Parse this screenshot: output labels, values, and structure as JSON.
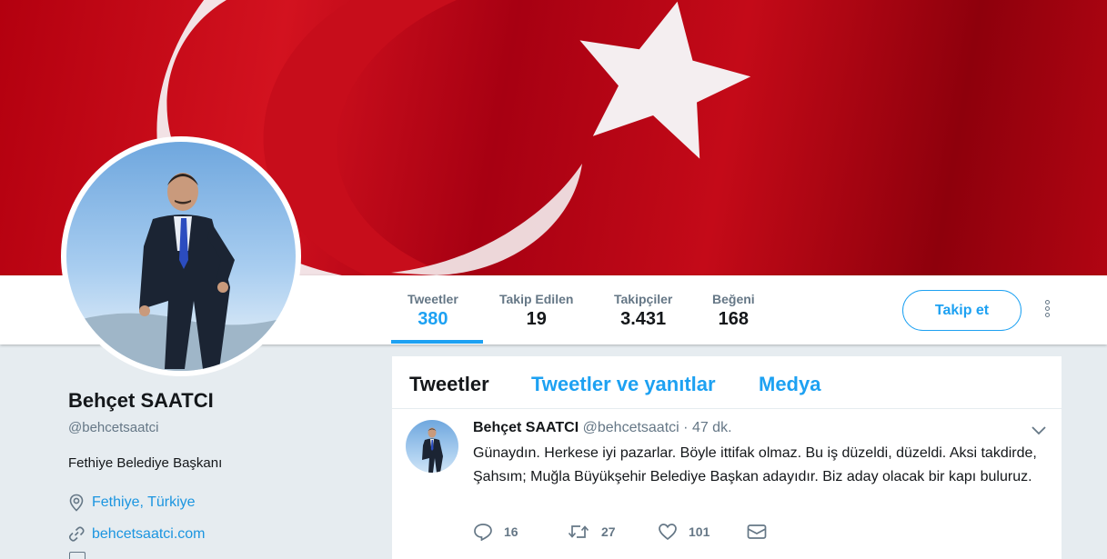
{
  "profile": {
    "name": "Behçet SAATCI",
    "handle": "@behcetsaatci",
    "bio": "Fethiye Belediye Başkanı",
    "location": "Fethiye, Türkiye",
    "website": "behcetsaatci.com"
  },
  "stats": [
    {
      "label": "Tweetler",
      "value": "380"
    },
    {
      "label": "Takip Edilen",
      "value": "19"
    },
    {
      "label": "Takipçiler",
      "value": "3.431"
    },
    {
      "label": "Beğeni",
      "value": "168"
    }
  ],
  "follow_button": "Takip et",
  "tabs": [
    {
      "label": "Tweetler"
    },
    {
      "label": "Tweetler ve yanıtlar"
    },
    {
      "label": "Medya"
    }
  ],
  "tweet": {
    "name": "Behçet SAATCI",
    "handle": "@behcetsaatci",
    "separator": "·",
    "time": "47 dk.",
    "text": "Günaydın. Herkese iyi pazarlar. Böyle ittifak olmaz. Bu iş düzeldi, düzeldi. Aksi takdirde, Şahsım; Muğla Büyükşehir Belediye Başkan adayıdır. Biz aday olacak bir kapı buluruz.",
    "replies": "16",
    "retweets": "27",
    "likes": "101"
  },
  "icons": {
    "location": "location-pin-icon",
    "link": "link-icon",
    "reply": "reply-icon",
    "retweet": "retweet-icon",
    "like": "heart-icon",
    "dm": "envelope-icon",
    "caret": "chevron-down-icon",
    "more": "more-vertical-icon"
  },
  "colors": {
    "accent": "#1da1f2",
    "flag_red": "#c8101e",
    "text_secondary": "#657786"
  }
}
